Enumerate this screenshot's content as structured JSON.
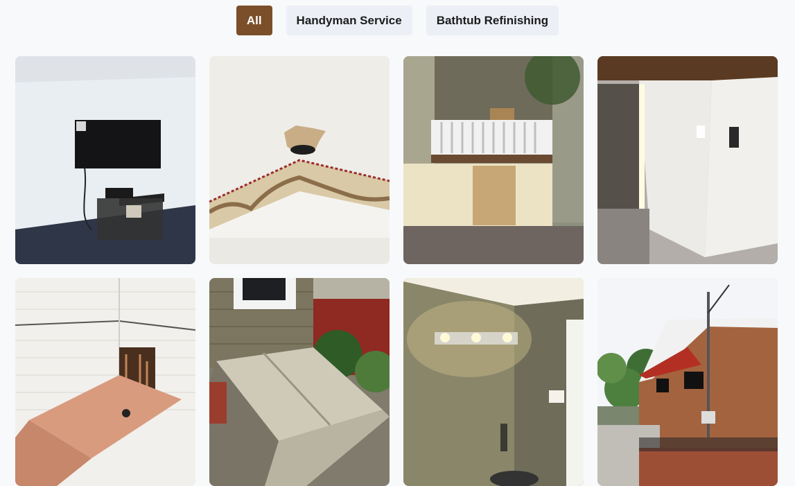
{
  "filters": [
    {
      "label": "All",
      "active": true
    },
    {
      "label": "Handyman Service",
      "active": false
    },
    {
      "label": "Bathtub Refinishing",
      "active": false
    }
  ],
  "gallery": [
    {
      "name": "tv-mount-room-photo"
    },
    {
      "name": "ceiling-damage-photo"
    },
    {
      "name": "porch-exterior-photo"
    },
    {
      "name": "basement-door-photo"
    },
    {
      "name": "tiled-bathroom-photo"
    },
    {
      "name": "cellar-door-photo"
    },
    {
      "name": "vanity-light-photo"
    },
    {
      "name": "brick-house-photo"
    }
  ],
  "colors": {
    "active_filter": "#7b4f2a",
    "inactive_filter": "#eceff6"
  }
}
